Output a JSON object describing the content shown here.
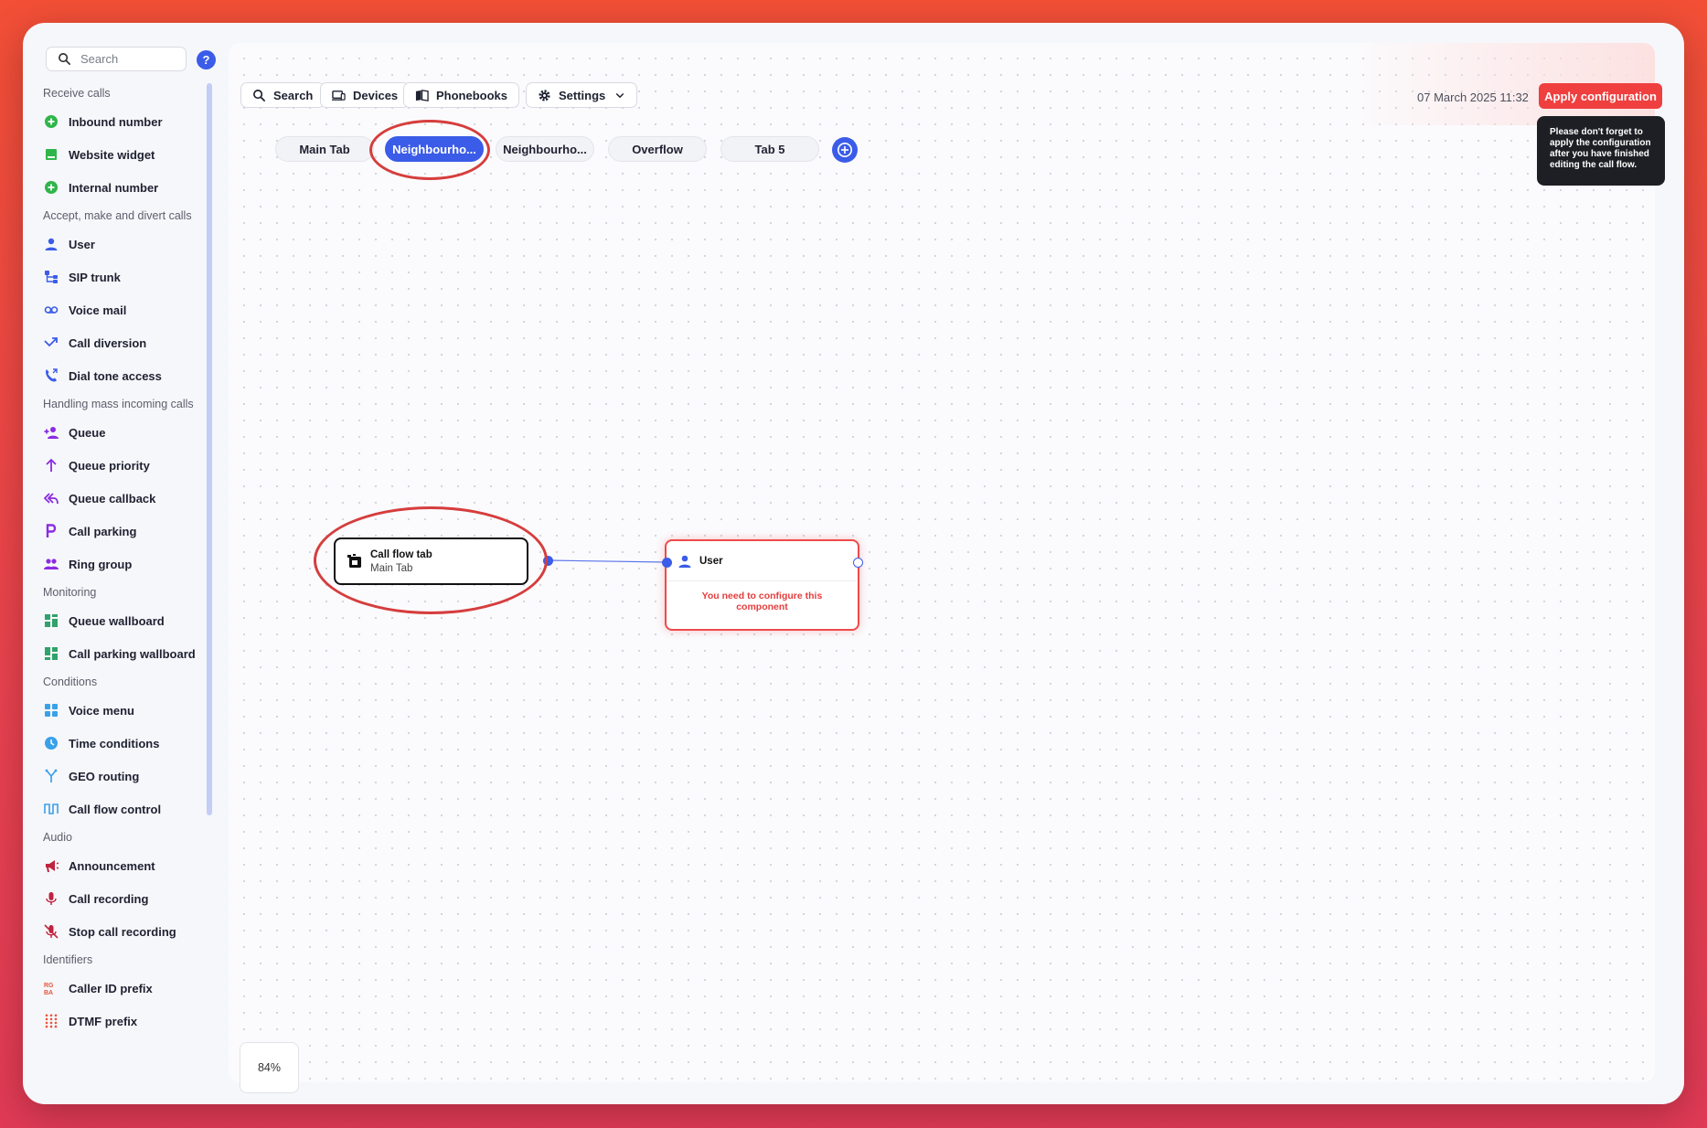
{
  "sidebar": {
    "search_placeholder": "Search",
    "help_label": "?",
    "sections": [
      {
        "title": "Receive calls",
        "items": [
          {
            "label": "Inbound number",
            "icon": "plus-circle-icon",
            "color": "#2fb54a"
          },
          {
            "label": "Website widget",
            "icon": "widget-icon",
            "color": "#2fb54a"
          },
          {
            "label": "Internal number",
            "icon": "plus-circle-icon",
            "color": "#2fb54a"
          }
        ]
      },
      {
        "title": "Accept, make and divert calls",
        "items": [
          {
            "label": "User",
            "icon": "user-icon",
            "color": "#3b5ce8"
          },
          {
            "label": "SIP trunk",
            "icon": "sip-trunk-icon",
            "color": "#3b5ce8"
          },
          {
            "label": "Voice mail",
            "icon": "voicemail-icon",
            "color": "#3b5ce8"
          },
          {
            "label": "Call diversion",
            "icon": "diversion-arrow-icon",
            "color": "#3b5ce8"
          },
          {
            "label": "Dial tone access",
            "icon": "phone-icon",
            "color": "#3b5ce8"
          }
        ]
      },
      {
        "title": "Handling mass incoming calls",
        "items": [
          {
            "label": "Queue",
            "icon": "add-person-icon",
            "color": "#8a2be2"
          },
          {
            "label": "Queue priority",
            "icon": "arrow-up-icon",
            "color": "#8a2be2"
          },
          {
            "label": "Queue callback",
            "icon": "reply-all-icon",
            "color": "#8a2be2"
          },
          {
            "label": "Call parking",
            "icon": "parking-icon",
            "color": "#8a2be2"
          },
          {
            "label": "Ring group",
            "icon": "group-icon",
            "color": "#8a2be2"
          }
        ]
      },
      {
        "title": "Monitoring",
        "items": [
          {
            "label": "Queue wallboard",
            "icon": "wallboard-icon",
            "color": "#2fa36b"
          },
          {
            "label": "Call parking wallboard",
            "icon": "dashboard-icon",
            "color": "#2fa36b"
          }
        ]
      },
      {
        "title": "Conditions",
        "items": [
          {
            "label": "Voice menu",
            "icon": "grid-icon",
            "color": "#3aa0e8"
          },
          {
            "label": "Time conditions",
            "icon": "clock-icon",
            "color": "#3aa0e8"
          },
          {
            "label": "GEO routing",
            "icon": "fork-icon",
            "color": "#3aa0e8"
          },
          {
            "label": "Call flow control",
            "icon": "flow-icon",
            "color": "#3aa0e8"
          }
        ]
      },
      {
        "title": "Audio",
        "items": [
          {
            "label": "Announcement",
            "icon": "megaphone-icon",
            "color": "#c0233f"
          },
          {
            "label": "Call recording",
            "icon": "microphone-icon",
            "color": "#c0233f"
          },
          {
            "label": "Stop call recording",
            "icon": "mic-off-icon",
            "color": "#c0233f"
          }
        ]
      },
      {
        "title": "Identifiers",
        "items": [
          {
            "label": "Caller ID prefix",
            "icon": "caller-id-icon",
            "color": "#e8543a"
          },
          {
            "label": "DTMF prefix",
            "icon": "dialpad-icon",
            "color": "#e8543a"
          }
        ]
      }
    ]
  },
  "toolbar": {
    "search_label": "Search",
    "devices_label": "Devices",
    "phonebooks_label": "Phonebooks",
    "settings_label": "Settings"
  },
  "header": {
    "timestamp": "07 March 2025 11:32",
    "apply_label": "Apply configuration",
    "tooltip": "Please don't forget to apply the configuration after you have finished editing the call flow."
  },
  "tabs": [
    "Main Tab",
    "Neighbourho...",
    "Neighbourho...",
    "Overflow",
    "Tab 5"
  ],
  "active_tab": 1,
  "nodes": {
    "call_flow_tab": {
      "title": "Call flow tab",
      "subtitle": "Main Tab"
    },
    "user": {
      "title": "User",
      "warning": "You need to configure this component"
    }
  },
  "zoom": "84%",
  "colors": {
    "accent": "#3b5ce8",
    "danger": "#ef3f3f",
    "annotation": "#d63d3d"
  }
}
